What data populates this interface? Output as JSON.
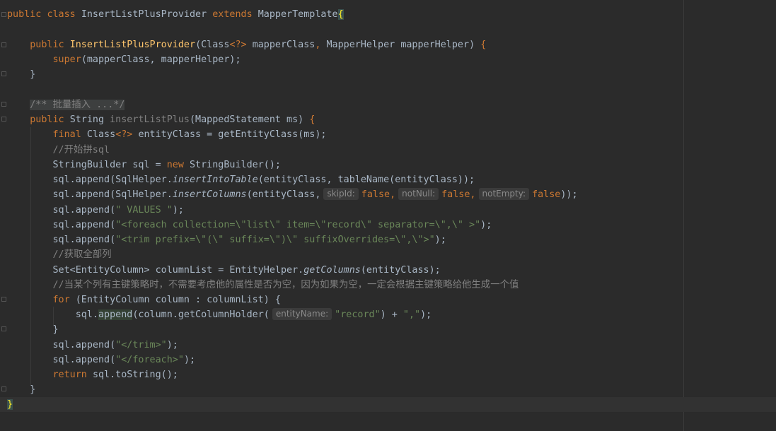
{
  "code": {
    "l1": {
      "kw1": "public",
      "kw2": "class",
      "cls": "InsertListPlusProvider",
      "kw3": "extends",
      "parent": "MapperTemplate",
      "brace": "{"
    },
    "l3": {
      "kw": "public",
      "ctor": "InsertListPlusProvider",
      "p1type": "Class",
      "generic": "<?>",
      "p1": "mapperClass",
      "comma": ",",
      "p2type": "MapperHelper",
      "p2": "mapperHelper",
      "close": ")",
      "brace": "{"
    },
    "l4": {
      "sup": "super",
      "args": "(mapperClass, mapperHelper);"
    },
    "l5": {
      "brace": "}"
    },
    "l7": {
      "comment": "/** 批量插入 ...*/"
    },
    "l8": {
      "kw": "public",
      "type": "String",
      "method": "insertListPlus",
      "params": "(MappedStatement ms)",
      "brace": "{"
    },
    "l9": {
      "kw": "final",
      "type": "Class",
      "generic": "<?>",
      "rest": "entityClass = getEntityClass(ms);"
    },
    "l10": {
      "comment": "//开始拼sql"
    },
    "l11": {
      "start": "StringBuilder sql = ",
      "kw": "new",
      "end": "StringBuilder();"
    },
    "l12": {
      "a": "sql.append(SqlHelper.",
      "m": "insertIntoTable",
      "b": "(entityClass, tableName(entityClass));"
    },
    "l13": {
      "a": "sql.append(SqlHelper.",
      "m": "insertColumns",
      "b": "(entityClass,",
      "h1": "skipId:",
      "v1": "false,",
      "h2": "notNull:",
      "v2": "false,",
      "h3": "notEmpty:",
      "v3": "false",
      "c": "));"
    },
    "l14": {
      "a": "sql.append(",
      "s": "\" VALUES \"",
      "b": ");"
    },
    "l15": {
      "a": "sql.append(",
      "s": "\"<foreach collection=\\\"list\\\" item=\\\"record\\\" separator=\\\",\\\" >\"",
      "b": ");"
    },
    "l16": {
      "a": "sql.append(",
      "s": "\"<trim prefix=\\\"(\\\" suffix=\\\")\\\" suffixOverrides=\\\",\\\">\"",
      "b": ");"
    },
    "l17": {
      "comment": "//获取全部列"
    },
    "l18": {
      "a": "Set<",
      "t": "EntityColumn",
      "b": "> columnList = EntityHelper.",
      "m": "getColumns",
      "c": "(entityClass);"
    },
    "l19": {
      "comment": "//当某个列有主键策略时，不需要考虑他的属性是否为空，因为如果为空，一定会根据主键策略给他生成一个值"
    },
    "l20": {
      "kw": "for",
      "rest": "(EntityColumn column : columnList)",
      "brace": "{"
    },
    "l21": {
      "a": "sql.",
      "m": "append",
      "b": "(column.getColumnHolder(",
      "h": "entityName:",
      "s": "\"record\"",
      "c": ") + ",
      "s2": "\",\"",
      "d": ");"
    },
    "l22": {
      "brace": "}"
    },
    "l23": {
      "a": "sql.append(",
      "s": "\"</trim>\"",
      "b": ");"
    },
    "l24": {
      "a": "sql.append(",
      "s": "\"</foreach>\"",
      "b": ");"
    },
    "l25": {
      "kw": "return",
      "rest": "sql.toString();"
    },
    "l26": {
      "brace": "}"
    },
    "l27": {
      "brace": "}"
    }
  }
}
